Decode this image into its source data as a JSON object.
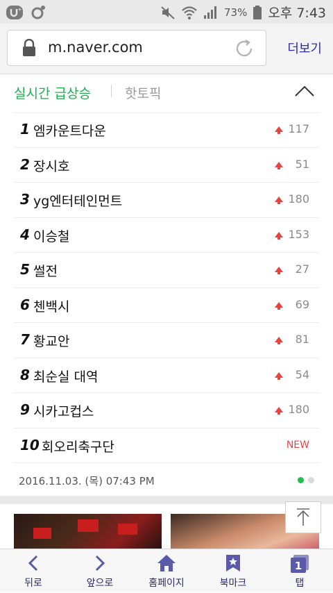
{
  "status_bar": {
    "battery_percent": "73%",
    "time": "오후 7:43"
  },
  "browser": {
    "url": "m.naver.com",
    "more_label": "더보기"
  },
  "section": {
    "active_tab": "실시간 급상승",
    "inactive_tab": "핫토픽"
  },
  "rankings": [
    {
      "rank": "1",
      "keyword": "엠카운트다운",
      "change": "117",
      "is_new": false
    },
    {
      "rank": "2",
      "keyword": "장시호",
      "change": "51",
      "is_new": false
    },
    {
      "rank": "3",
      "keyword": "yg엔터테인먼트",
      "change": "180",
      "is_new": false
    },
    {
      "rank": "4",
      "keyword": "이승철",
      "change": "153",
      "is_new": false
    },
    {
      "rank": "5",
      "keyword": "썰전",
      "change": "27",
      "is_new": false
    },
    {
      "rank": "6",
      "keyword": "첸백시",
      "change": "69",
      "is_new": false
    },
    {
      "rank": "7",
      "keyword": "황교안",
      "change": "81",
      "is_new": false
    },
    {
      "rank": "8",
      "keyword": "최순실 대역",
      "change": "54",
      "is_new": false
    },
    {
      "rank": "9",
      "keyword": "시카고컵스",
      "change": "180",
      "is_new": false
    },
    {
      "rank": "10",
      "keyword": "회오리축구단",
      "change": "NEW",
      "is_new": true
    }
  ],
  "timestamp": "2016.11.03. (목) 07:43 PM",
  "pagination": {
    "current": 1,
    "total": 2
  },
  "bottom_nav": {
    "back": "뒤로",
    "forward": "앞으로",
    "home": "홈페이지",
    "bookmarks": "북마크",
    "tabs": "탭",
    "tab_count": "1"
  },
  "colors": {
    "accent_green": "#19b24a",
    "link_blue": "#2d2eaa",
    "up_red": "#e8443f",
    "nav_icon": "#5a5aa8"
  },
  "icons": [
    "u-plus-icon",
    "camera-dot-icon",
    "mute-icon",
    "wifi-icon",
    "signal-icon",
    "battery-icon",
    "lock-icon",
    "reload-icon",
    "chevron-up-icon",
    "up-arrow-icon",
    "scroll-top-icon",
    "back-icon",
    "forward-icon",
    "home-icon",
    "bookmark-icon",
    "tabs-icon"
  ]
}
